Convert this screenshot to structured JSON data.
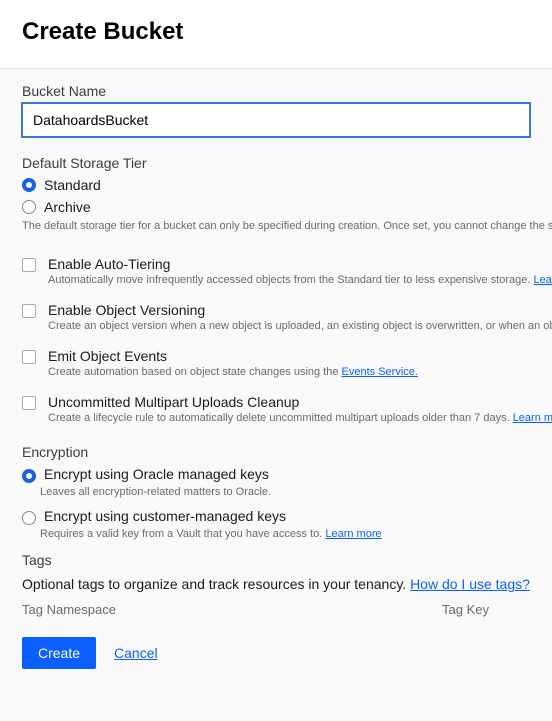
{
  "header": {
    "title": "Create Bucket"
  },
  "bucket_name": {
    "label": "Bucket Name",
    "value": "DatahoardsBucket"
  },
  "storage_tier": {
    "label": "Default Storage Tier",
    "options": {
      "standard": "Standard",
      "archive": "Archive"
    },
    "selected": "standard",
    "note": "The default storage tier for a bucket can only be specified during creation. Once set, you cannot change the st"
  },
  "features": {
    "auto_tiering": {
      "title": "Enable Auto-Tiering",
      "desc": "Automatically move infrequently accessed objects from the Standard tier to less expensive storage. ",
      "link": "Lear"
    },
    "versioning": {
      "title": "Enable Object Versioning",
      "desc": "Create an object version when a new object is uploaded, an existing object is overwritten, or when an ob"
    },
    "events": {
      "title": "Emit Object Events",
      "desc": "Create automation based on object state changes using the ",
      "link": "Events Service."
    },
    "mpu_cleanup": {
      "title": "Uncommitted Multipart Uploads Cleanup",
      "desc": "Create a lifecycle rule to automatically delete uncommitted multipart uploads older than 7 days. ",
      "link": "Learn more"
    }
  },
  "encryption": {
    "label": "Encryption",
    "oracle": {
      "title": "Encrypt using Oracle managed keys",
      "desc": "Leaves all encryption-related matters to Oracle."
    },
    "customer": {
      "title": "Encrypt using customer-managed keys",
      "desc": "Requires a valid key from a Vault that you have access to. ",
      "link": "Learn more"
    },
    "selected": "oracle"
  },
  "tags": {
    "label": "Tags",
    "desc": "Optional tags to organize and track resources in your tenancy. ",
    "link": "How do I use tags?",
    "columns": {
      "namespace": "Tag Namespace",
      "key": "Tag Key"
    }
  },
  "footer": {
    "create": "Create",
    "cancel": "Cancel"
  }
}
